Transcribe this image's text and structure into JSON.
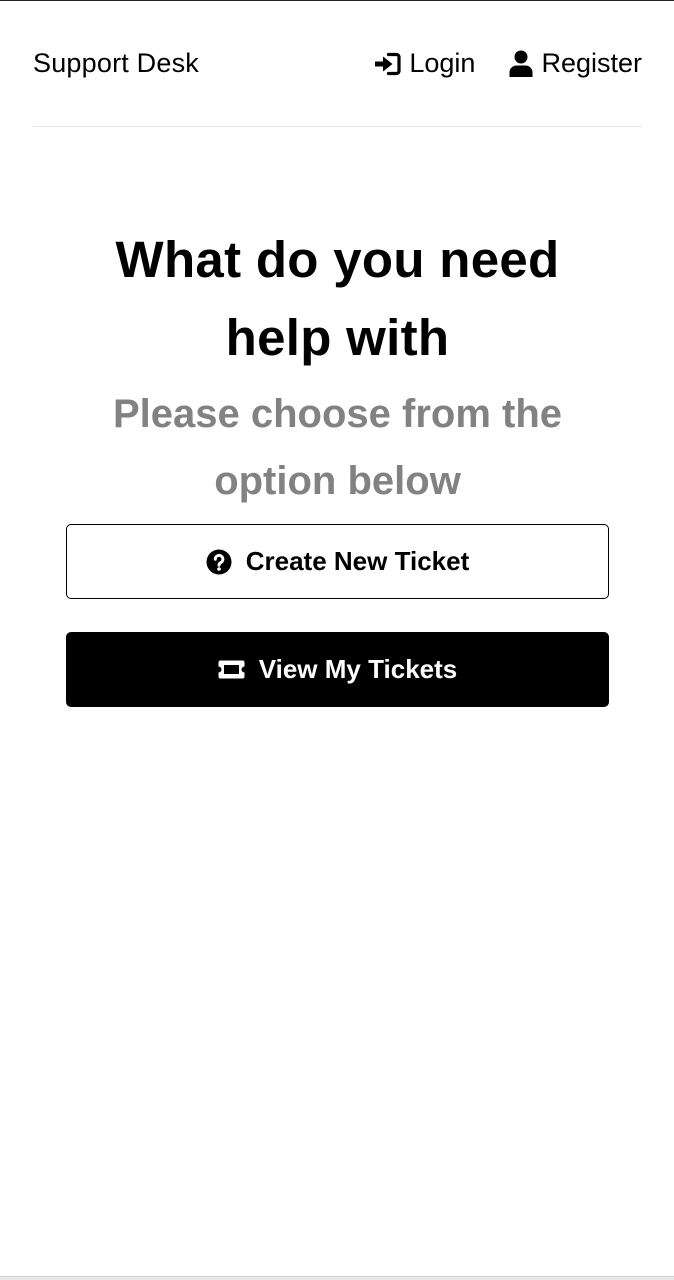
{
  "header": {
    "brand": "Support Desk",
    "nav": {
      "login_label": "Login",
      "login_icon": "sign-in-icon",
      "register_label": "Register",
      "register_icon": "user-icon"
    }
  },
  "main": {
    "heading": "What do you need help with",
    "subheading": "Please choose from the option below",
    "buttons": {
      "create_label": "Create New Ticket",
      "create_icon": "question-circle-icon",
      "view_label": "View My Tickets",
      "view_icon": "ticket-icon"
    }
  },
  "colors": {
    "text": "#000000",
    "muted": "#828282",
    "background": "#ffffff",
    "divider": "#e6e6e6"
  }
}
